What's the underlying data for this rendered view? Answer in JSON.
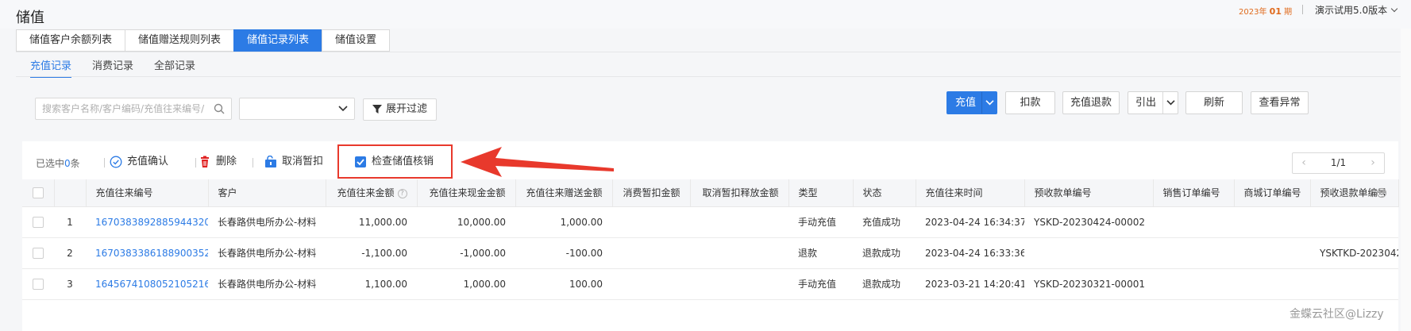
{
  "header": {
    "title": "储值",
    "period_prefix": "2023年",
    "period_value": "01",
    "period_suffix": "期",
    "version": "演示试用5.0版本"
  },
  "tabs": [
    "储值客户余额列表",
    "储值赠送规则列表",
    "储值记录列表",
    "储值设置"
  ],
  "active_tab": "储值记录列表",
  "subtabs": [
    "充值记录",
    "消费记录",
    "全部记录"
  ],
  "active_subtab": "充值记录",
  "filter": {
    "search_placeholder": "搜索客户名称/客户编码/充值往来编号/",
    "select_value": "",
    "expand_label": "展开过滤"
  },
  "toolbar": {
    "recharge": "充值",
    "deduct": "扣款",
    "refund": "充值退款",
    "export": "引出",
    "refresh": "刷新",
    "view_exception": "查看异常"
  },
  "table_actions": {
    "selected_prefix": "已选中",
    "selected_count": "0",
    "selected_suffix": "条",
    "confirm": "充值确认",
    "delete": "删除",
    "cancel_hold": "取消暂扣",
    "check_verify": "检查储值核销"
  },
  "pager": {
    "text": "1/1",
    "prev": "‹",
    "next": "›"
  },
  "colors": {
    "primary": "#2c7be5",
    "highlight": "#e8392c",
    "danger": "#e02020"
  },
  "columns": [
    "充值往来编号",
    "客户",
    "充值往来金额",
    "充值往来现金金额",
    "充值往来赠送金额",
    "消费暂扣金额",
    "取消暂扣释放金额",
    "类型",
    "状态",
    "充值往来时间",
    "预收款单编号",
    "销售订单编号",
    "商城订单编号",
    "预收退款单编号"
  ],
  "rows": [
    {
      "idx": "1",
      "no": "1670383892885944320",
      "customer": "长春路供电所办公-材料",
      "amount": "11,000.00",
      "cash": "10,000.00",
      "gift": "1,000.00",
      "hold": "",
      "release": "",
      "type": "手动充值",
      "status": "充值成功",
      "time": "2023-04-24 16:34:37",
      "receipt": "YSKD-20230424-00002",
      "sales": "",
      "mall": "",
      "refund": ""
    },
    {
      "idx": "2",
      "no": "1670383386188900352",
      "customer": "长春路供电所办公-材料",
      "amount": "-1,100.00",
      "cash": "-1,000.00",
      "gift": "-100.00",
      "hold": "",
      "release": "",
      "type": "退款",
      "status": "退款成功",
      "time": "2023-04-24 16:33:36",
      "receipt": "",
      "sales": "",
      "mall": "",
      "refund": "YSKTKD-20230424-"
    },
    {
      "idx": "3",
      "no": "1645674108052105216",
      "customer": "长春路供电所办公-材料",
      "amount": "1,100.00",
      "cash": "1,000.00",
      "gift": "100.00",
      "hold": "",
      "release": "",
      "type": "手动充值",
      "status": "退款成功",
      "time": "2023-03-21 14:20:41",
      "receipt": "YSKD-20230321-00001",
      "sales": "",
      "mall": "",
      "refund": ""
    }
  ],
  "watermark": "金蝶云社区@Lizzy"
}
